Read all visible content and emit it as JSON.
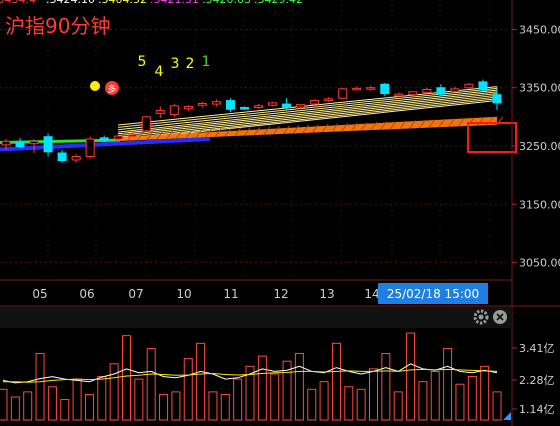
{
  "header_values": [
    ".3434.4",
    ".3424.10",
    ".3404.52",
    ".3421.51",
    ".3420.63",
    ".3429.42"
  ],
  "header_colors": [
    "#ff3b30",
    "#ffffff",
    "#ffff40",
    "#ff40ff",
    "#40ff40",
    "#40ff40"
  ],
  "title": "沪指90分钟",
  "markers": [
    {
      "label": "5",
      "color": "#ffff00"
    },
    {
      "label": "4",
      "color": "#ffff00"
    },
    {
      "label": "3",
      "color": "#ffff00"
    },
    {
      "label": "2",
      "color": "#ffff00"
    },
    {
      "label": "1",
      "color": "#33dd33"
    }
  ],
  "badge": {
    "label": "多",
    "dot_color": "#ffee00",
    "badge_color": "#ff3b30"
  },
  "cursor_date": "25/02/18 15:00",
  "volume_panel": {
    "icons": [
      "gear-icon",
      "close-icon"
    ],
    "y_ticks": [
      "3.41亿",
      "2.28亿",
      "1.14亿"
    ]
  },
  "chart_data": {
    "type": "candlestick",
    "title": "沪指90分钟",
    "x_ticks": [
      "05",
      "06",
      "07",
      "10",
      "11",
      "12",
      "13",
      "14"
    ],
    "y_ticks": [
      3450,
      3350,
      3250,
      3150,
      3050
    ],
    "ylim": [
      3020,
      3480
    ],
    "colors": {
      "up": "#ff3b30",
      "down": "#00e5ff"
    },
    "candles": [
      {
        "o": 3252,
        "h": 3262,
        "l": 3243,
        "c": 3258
      },
      {
        "o": 3256,
        "h": 3264,
        "l": 3247,
        "c": 3249
      },
      {
        "o": 3254,
        "h": 3262,
        "l": 3238,
        "c": 3258
      },
      {
        "o": 3266,
        "h": 3272,
        "l": 3232,
        "c": 3240
      },
      {
        "o": 3238,
        "h": 3243,
        "l": 3222,
        "c": 3225
      },
      {
        "o": 3226,
        "h": 3236,
        "l": 3221,
        "c": 3232
      },
      {
        "o": 3232,
        "h": 3266,
        "l": 3228,
        "c": 3262
      },
      {
        "o": 3264,
        "h": 3268,
        "l": 3257,
        "c": 3260
      },
      {
        "o": 3262,
        "h": 3270,
        "l": 3258,
        "c": 3267
      },
      {
        "o": 3268,
        "h": 3272,
        "l": 3264,
        "c": 3269
      },
      {
        "o": 3276,
        "h": 3302,
        "l": 3274,
        "c": 3300
      },
      {
        "o": 3306,
        "h": 3318,
        "l": 3298,
        "c": 3311
      },
      {
        "o": 3304,
        "h": 3322,
        "l": 3300,
        "c": 3319
      },
      {
        "o": 3314,
        "h": 3320,
        "l": 3310,
        "c": 3318
      },
      {
        "o": 3320,
        "h": 3326,
        "l": 3316,
        "c": 3323
      },
      {
        "o": 3322,
        "h": 3330,
        "l": 3318,
        "c": 3326
      },
      {
        "o": 3328,
        "h": 3332,
        "l": 3308,
        "c": 3313
      },
      {
        "o": 3316,
        "h": 3318,
        "l": 3312,
        "c": 3315
      },
      {
        "o": 3316,
        "h": 3322,
        "l": 3314,
        "c": 3319
      },
      {
        "o": 3320,
        "h": 3326,
        "l": 3318,
        "c": 3324
      },
      {
        "o": 3322,
        "h": 3332,
        "l": 3312,
        "c": 3316
      },
      {
        "o": 3317,
        "h": 3322,
        "l": 3313,
        "c": 3321
      },
      {
        "o": 3322,
        "h": 3330,
        "l": 3320,
        "c": 3328
      },
      {
        "o": 3328,
        "h": 3334,
        "l": 3326,
        "c": 3331
      },
      {
        "o": 3332,
        "h": 3350,
        "l": 3330,
        "c": 3348
      },
      {
        "o": 3348,
        "h": 3352,
        "l": 3346,
        "c": 3349
      },
      {
        "o": 3348,
        "h": 3354,
        "l": 3345,
        "c": 3350
      },
      {
        "o": 3356,
        "h": 3358,
        "l": 3336,
        "c": 3340
      },
      {
        "o": 3336,
        "h": 3342,
        "l": 3334,
        "c": 3339
      },
      {
        "o": 3338,
        "h": 3344,
        "l": 3336,
        "c": 3343
      },
      {
        "o": 3342,
        "h": 3350,
        "l": 3338,
        "c": 3347
      },
      {
        "o": 3350,
        "h": 3356,
        "l": 3336,
        "c": 3339
      },
      {
        "o": 3344,
        "h": 3352,
        "l": 3342,
        "c": 3348
      },
      {
        "o": 3350,
        "h": 3358,
        "l": 3348,
        "c": 3356
      },
      {
        "o": 3360,
        "h": 3364,
        "l": 3344,
        "c": 3346
      },
      {
        "o": 3338,
        "h": 3352,
        "l": 3312,
        "c": 3324
      }
    ],
    "ma_fan": {
      "start": [
        3260,
        3262,
        3265,
        3268,
        3271,
        3274,
        3278,
        3282,
        3286
      ],
      "end": [
        3328,
        3331,
        3334,
        3337,
        3340,
        3343,
        3346,
        3349,
        3352
      ]
    },
    "green_line": {
      "from": 3256,
      "to": 3260
    },
    "blue_line": {
      "from": 3244,
      "to": 3262
    },
    "orange_band": {
      "from": 3262,
      "to": 3290
    },
    "volume": {
      "bars": [
        1.2,
        0.9,
        1.1,
        2.6,
        1.3,
        0.8,
        1.6,
        1.0,
        1.7,
        2.2,
        3.3,
        1.6,
        2.8,
        1.0,
        1.1,
        2.4,
        3.0,
        1.1,
        1.0,
        1.6,
        2.1,
        2.5,
        1.8,
        2.3,
        2.6,
        1.2,
        1.5,
        3.0,
        1.3,
        1.2,
        2.0,
        2.6,
        1.1,
        3.4,
        1.5,
        1.9,
        2.8,
        1.4,
        1.7,
        2.1,
        1.1
      ],
      "ylim": [
        0,
        3.6
      ],
      "ma_white": [
        1.55,
        1.45,
        1.5,
        1.62,
        1.7,
        1.6,
        1.55,
        1.5,
        1.68,
        1.8,
        2.0,
        1.85,
        1.9,
        1.7,
        1.65,
        1.75,
        1.9,
        1.8,
        1.6,
        1.65,
        1.8,
        2.0,
        1.9,
        1.95,
        2.1,
        1.9,
        1.85,
        2.05,
        1.9,
        1.8,
        1.9,
        2.05,
        1.9,
        2.2,
        2.0,
        1.95,
        2.1,
        1.9,
        1.85,
        1.95,
        1.85
      ],
      "ma_yellow": [
        1.5,
        1.5,
        1.48,
        1.5,
        1.55,
        1.58,
        1.6,
        1.58,
        1.6,
        1.65,
        1.72,
        1.75,
        1.8,
        1.78,
        1.75,
        1.76,
        1.8,
        1.82,
        1.78,
        1.76,
        1.78,
        1.82,
        1.85,
        1.86,
        1.9,
        1.9,
        1.88,
        1.9,
        1.92,
        1.9,
        1.9,
        1.92,
        1.9,
        1.96,
        1.98,
        1.96,
        1.98,
        1.96,
        1.94,
        1.92,
        1.9
      ]
    }
  }
}
